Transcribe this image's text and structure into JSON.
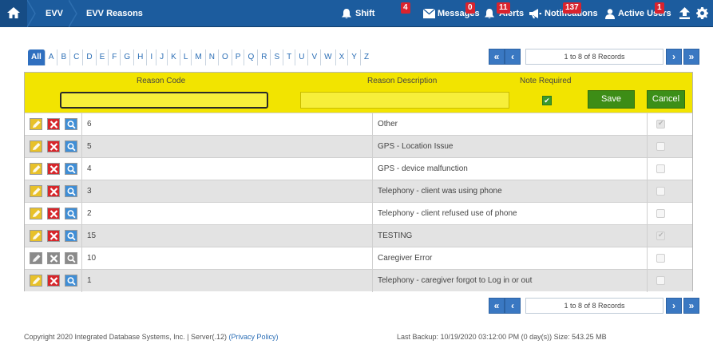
{
  "breadcrumb": {
    "level1": "EVV",
    "level2": "EVV Reasons"
  },
  "topnav": {
    "shift_requests": {
      "label": "Shift Requests",
      "badge": "4"
    },
    "messages": {
      "label": "Messages",
      "badge": "0"
    },
    "alerts": {
      "label": "Alerts",
      "badge": "11"
    },
    "notifications": {
      "label": "Notifications",
      "badge": "137"
    },
    "active_users": {
      "label": "Active Users",
      "badge": "1"
    }
  },
  "alphabet": [
    "All",
    "A",
    "B",
    "C",
    "D",
    "E",
    "F",
    "G",
    "H",
    "I",
    "J",
    "K",
    "L",
    "M",
    "N",
    "O",
    "P",
    "Q",
    "R",
    "S",
    "T",
    "U",
    "V",
    "W",
    "X",
    "Y",
    "Z"
  ],
  "pager": {
    "info": "1 to 8 of 8 Records",
    "first": "«",
    "prev": "‹",
    "next": "›",
    "last": "»"
  },
  "grid": {
    "columns": {
      "code": "Reason Code",
      "description": "Reason Description",
      "note": "Note Required"
    },
    "edit": {
      "code_value": "",
      "description_value": "",
      "note_required": true
    },
    "save_label": "Save",
    "cancel_label": "Cancel",
    "rows": [
      {
        "code": "6",
        "description": "Other",
        "note": true,
        "enabled": true
      },
      {
        "code": "5",
        "description": "GPS - Location Issue",
        "note": false,
        "enabled": true
      },
      {
        "code": "4",
        "description": "GPS - device malfunction",
        "note": false,
        "enabled": true
      },
      {
        "code": "3",
        "description": "Telephony - client was using phone",
        "note": false,
        "enabled": true
      },
      {
        "code": "2",
        "description": "Telephony - client refused use of phone",
        "note": false,
        "enabled": true
      },
      {
        "code": "15",
        "description": "TESTING",
        "note": true,
        "enabled": true
      },
      {
        "code": "10",
        "description": "Caregiver Error",
        "note": false,
        "enabled": false
      },
      {
        "code": "1",
        "description": "Telephony - caregiver forgot to Log in or out",
        "note": false,
        "enabled": true
      }
    ]
  },
  "footer": {
    "copyright": "Copyright 2020 Integrated Database Systems, Inc. | Server(.12)",
    "privacy_link": "(Privacy Policy)",
    "backup": "Last Backup: 10/19/2020 03:12:00 PM (0 day(s)) Size: 543.25 MB"
  },
  "colors": {
    "topbar": "#1c5c9e",
    "header_yellow": "#f2e400",
    "accent_blue": "#3a78c2",
    "button_green": "#3d8d16",
    "badge_red": "#d9232e"
  }
}
